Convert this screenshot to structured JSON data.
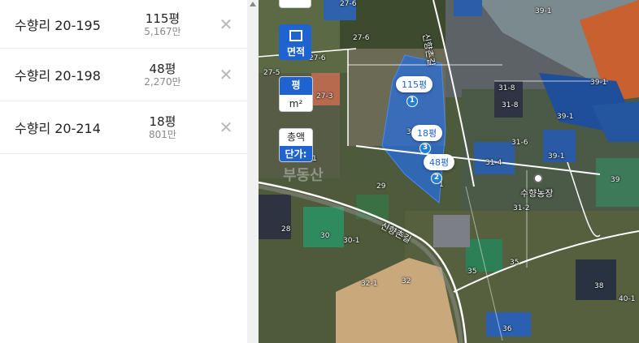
{
  "list": [
    {
      "address": "수향리 20-195",
      "area": "115평",
      "price": "5,167만"
    },
    {
      "address": "수향리 20-198",
      "area": "48평",
      "price": "2,270만"
    },
    {
      "address": "수향리 20-214",
      "area": "18평",
      "price": "801만"
    }
  ],
  "delete_glyph": "✕",
  "controls": {
    "area_label": "면적",
    "unit_pyeong": "평",
    "unit_m2": "m²",
    "price_total": "총액",
    "price_unit": "단가:"
  },
  "markers": [
    {
      "label": "115평",
      "num": "1"
    },
    {
      "label": "18평",
      "num": "3"
    },
    {
      "label": "48평",
      "num": "2"
    }
  ],
  "watermark": "부동산",
  "place": "수향농장",
  "road_name_1": "신향촌길",
  "road_name_2": "신향촌길",
  "parcel_labels": [
    "27-6",
    "27-6",
    "27-6",
    "27-5",
    "27-3",
    "39-1",
    "39-1",
    "39-1",
    "39-1",
    "31-8",
    "31-8",
    "31-6",
    "31-4",
    "31-2",
    "39",
    "29",
    "28",
    "30",
    "30-1",
    "32-1",
    "32",
    "35",
    "35",
    "36",
    "38",
    "40-1",
    "3",
    "1",
    "1"
  ]
}
